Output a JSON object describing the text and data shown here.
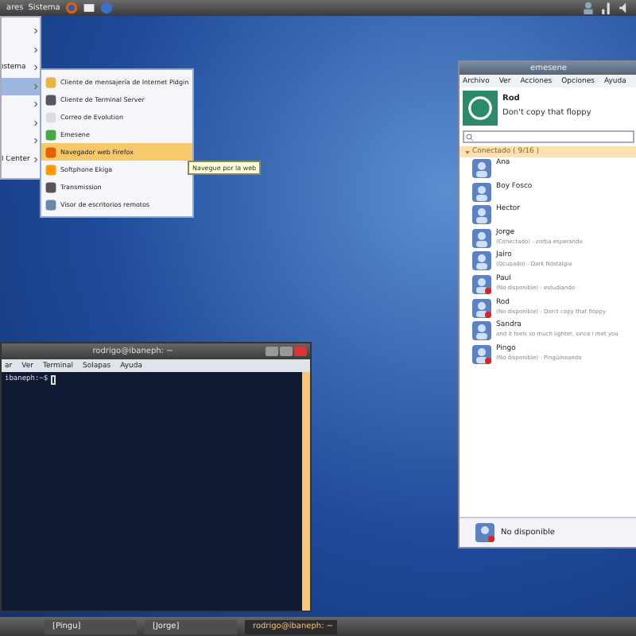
{
  "top_panel": {
    "menus": [
      {
        "label": "ares"
      },
      {
        "label": "Sistema"
      }
    ]
  },
  "main_menu": {
    "items": [
      {
        "selected": false
      },
      {
        "selected": false
      },
      {
        "label": "istema",
        "selected": false
      },
      {
        "selected": true
      },
      {
        "selected": false
      },
      {
        "selected": false
      },
      {
        "selected": false
      },
      {
        "label": "l Center",
        "selected": false
      }
    ]
  },
  "submenu": {
    "items": [
      {
        "label": "Cliente de mensajería de Internet Pidgin",
        "selected": false
      },
      {
        "label": "Cliente de Terminal Server",
        "selected": false
      },
      {
        "label": "Correo de Evolution",
        "selected": false
      },
      {
        "label": "Emesene",
        "selected": false
      },
      {
        "label": "Navegador web Firefox",
        "selected": true
      },
      {
        "label": "Softphone Ekiga",
        "selected": false
      },
      {
        "label": "Transmission",
        "selected": false
      },
      {
        "label": "Visor de escritorios remotos",
        "selected": false
      }
    ]
  },
  "tooltip": "Navegue por la web",
  "terminal": {
    "title": "rodrigo@ibaneph: ~",
    "menus": [
      "ar",
      "Ver",
      "Terminal",
      "Solapas",
      "Ayuda"
    ],
    "prompt": "ibaneph:~$"
  },
  "emesene": {
    "title": "emesene",
    "menus": [
      "Archivo",
      "Ver",
      "Acciones",
      "Opciones",
      "Ayuda"
    ],
    "nick": "Rod",
    "message": "Don't copy that floppy",
    "group": "Conectado ( 9/16 )",
    "contacts": [
      {
        "name": "Ana",
        "away": false
      },
      {
        "name": "Boy Fosco",
        "away": false
      },
      {
        "name": "Hector",
        "away": false
      },
      {
        "name": "Jorge",
        "status": "(Conectado) - zorba esperando",
        "away": false
      },
      {
        "name": "Jairo",
        "status": "(Ocupado) - Dark Nostalgia",
        "away": false
      },
      {
        "name": "Paul",
        "status": "(No disponible) - estudiando",
        "away": true
      },
      {
        "name": "Rod",
        "status": "(No disponible) - Don't copy that floppy",
        "away": true
      },
      {
        "name": "Sandra",
        "status": "and it feels so much lighter, since i met you",
        "away": false
      },
      {
        "name": "Pingo",
        "status": "(No disponible) - Pingüineando",
        "away": true
      }
    ],
    "own_status": "No disponible"
  },
  "taskbar": {
    "items": [
      {
        "label": "[Pingu]",
        "selected": false
      },
      {
        "label": "[Jorge]",
        "selected": false
      },
      {
        "label": "rodrigo@ibaneph: ~",
        "selected": true
      }
    ]
  }
}
